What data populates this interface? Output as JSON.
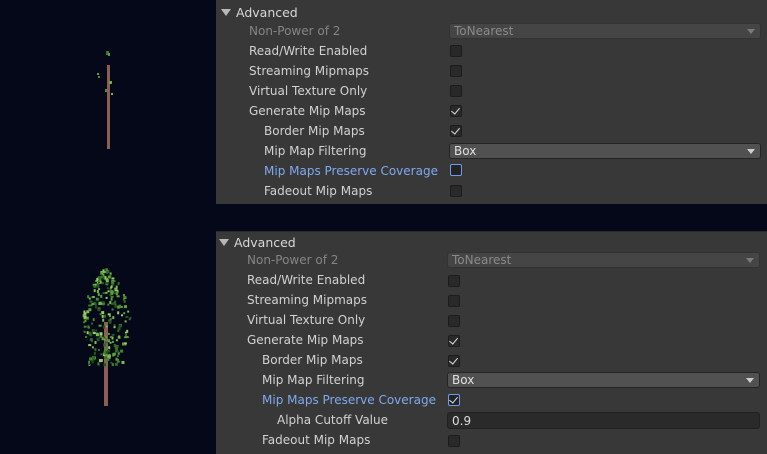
{
  "colors": {
    "background": "#040818",
    "panel": "#383838",
    "accent_label": "#7fa9ef"
  },
  "top_panel": {
    "header": "Advanced",
    "non_power_label": "Non-Power of 2",
    "non_power_value": "ToNearest",
    "read_write_label": "Read/Write Enabled",
    "read_write_checked": false,
    "streaming_label": "Streaming Mipmaps",
    "streaming_checked": false,
    "virtual_label": "Virtual Texture Only",
    "virtual_checked": false,
    "generate_label": "Generate Mip Maps",
    "generate_checked": true,
    "border_label": "Border Mip Maps",
    "border_checked": true,
    "filtering_label": "Mip Map Filtering",
    "filtering_value": "Box",
    "preserve_label": "Mip Maps Preserve Coverage",
    "preserve_checked": false,
    "fadeout_label": "Fadeout Mip Maps",
    "fadeout_checked": false
  },
  "bottom_panel": {
    "header": "Advanced",
    "non_power_label": "Non-Power of 2",
    "non_power_value": "ToNearest",
    "read_write_label": "Read/Write Enabled",
    "read_write_checked": false,
    "streaming_label": "Streaming Mipmaps",
    "streaming_checked": false,
    "virtual_label": "Virtual Texture Only",
    "virtual_checked": false,
    "generate_label": "Generate Mip Maps",
    "generate_checked": true,
    "border_label": "Border Mip Maps",
    "border_checked": true,
    "filtering_label": "Mip Map Filtering",
    "filtering_value": "Box",
    "preserve_label": "Mip Maps Preserve Coverage",
    "preserve_checked": true,
    "alpha_label": "Alpha Cutoff Value",
    "alpha_value": "0.9",
    "fadeout_label": "Fadeout Mip Maps",
    "fadeout_checked": false
  },
  "icons": {
    "foldout": "triangle-down-icon",
    "check": "checkmark-icon",
    "dropdown": "chevron-down-icon",
    "preview_top": "tree-sparse-preview",
    "preview_bottom": "tree-full-preview"
  }
}
